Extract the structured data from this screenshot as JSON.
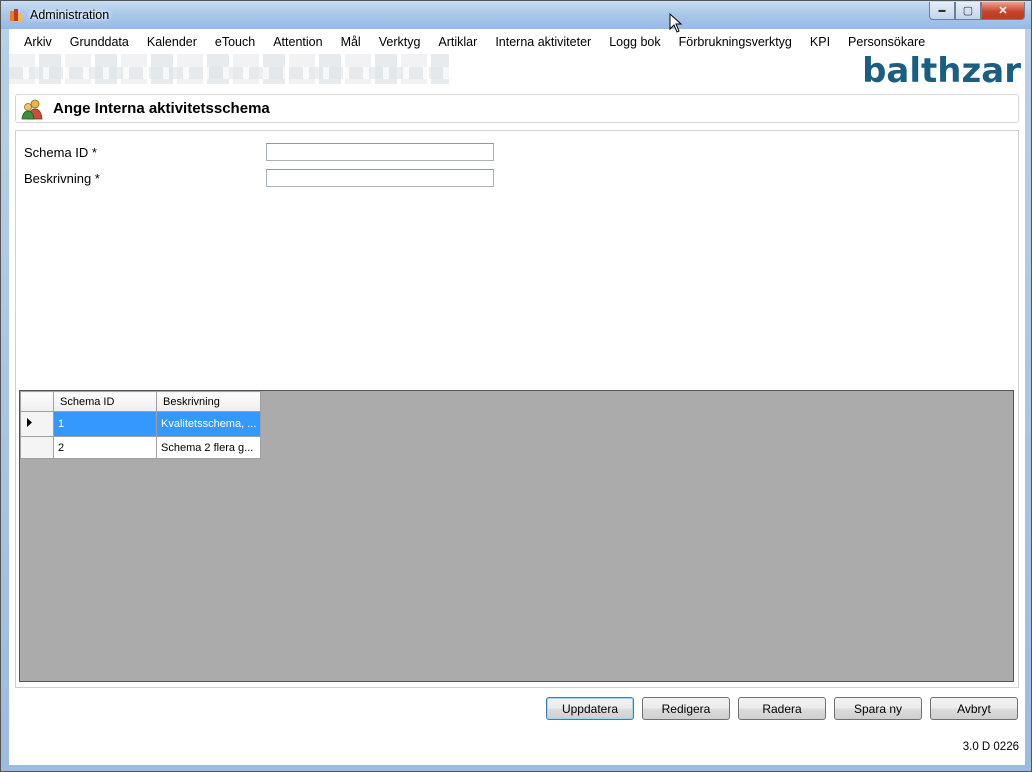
{
  "window": {
    "title": "Administration",
    "minimize_glyph": "▬",
    "maximize_glyph": "▢",
    "close_glyph": "✕"
  },
  "menu": [
    "Arkiv",
    "Grunddata",
    "Kalender",
    "eTouch",
    "Attention",
    "Mål",
    "Verktyg",
    "Artiklar",
    "Interna aktiviteter",
    "Logg bok",
    "Förbrukningsverktyg",
    "KPI",
    "Personsökare"
  ],
  "brand": {
    "logo_text": "balthzar",
    "color": "#1b5e83"
  },
  "header": {
    "title": "Ange Interna aktivitetsschema",
    "icon": "users-icon"
  },
  "form": {
    "schema_id_label": "Schema ID *",
    "schema_id_value": "",
    "beskrivning_label": "Beskrivning *",
    "beskrivning_value": ""
  },
  "grid": {
    "columns": [
      "Schema ID",
      "Beskrivning"
    ],
    "rows": [
      {
        "id": "1",
        "beskrivning": "Kvalitetsschema, ...",
        "selected": true
      },
      {
        "id": "2",
        "beskrivning": "Schema 2 flera g...",
        "selected": false
      }
    ],
    "selection_color": "#3399ff"
  },
  "buttons": {
    "update": "Uppdatera",
    "edit": "Redigera",
    "delete": "Radera",
    "save_new": "Spara ny",
    "cancel": "Avbryt"
  },
  "status": {
    "version": "3.0 D 0226"
  }
}
